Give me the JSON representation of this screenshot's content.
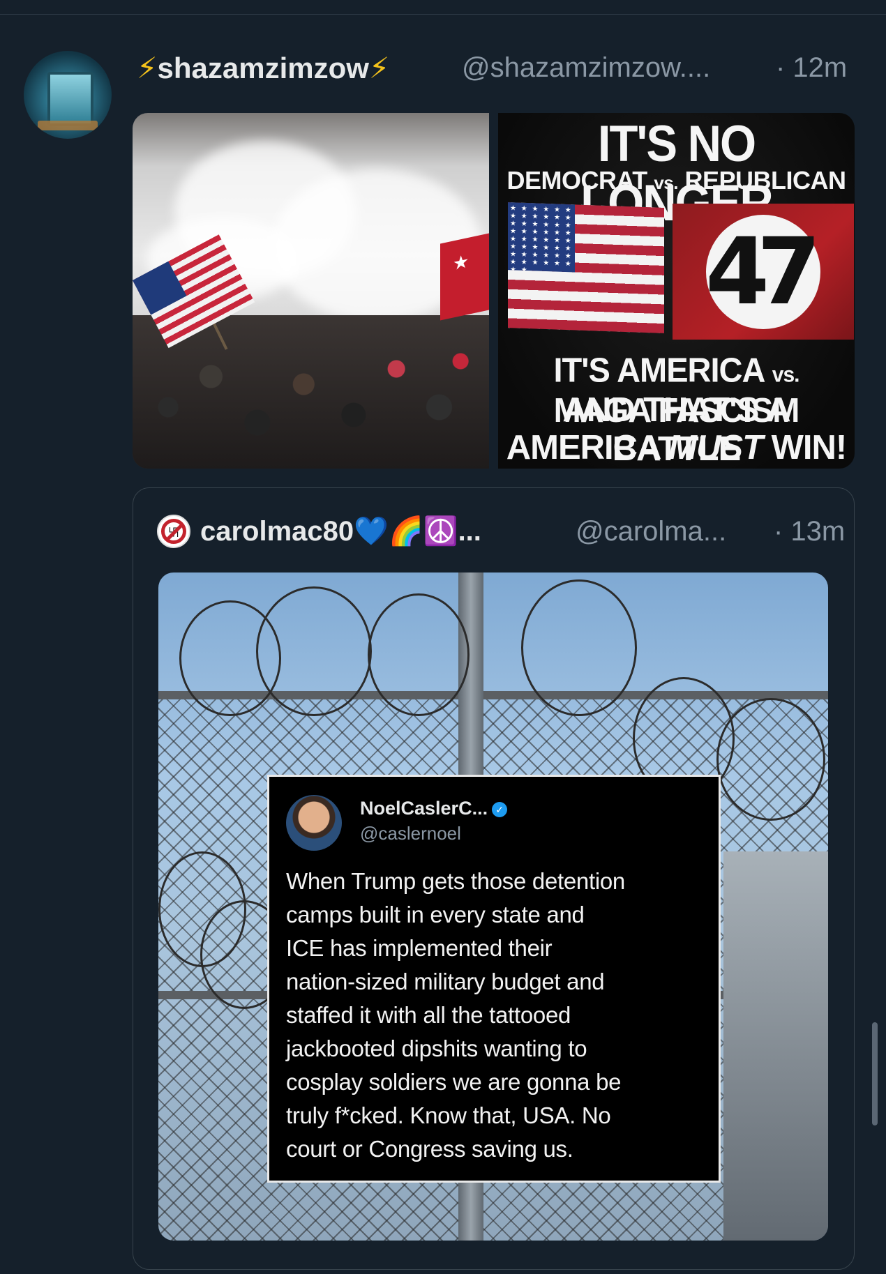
{
  "post": {
    "display_name": "shazamzimzow",
    "name_prefix_emoji": "⚡",
    "name_suffix_emoji": "⚡",
    "handle": "@shazamzimzow....",
    "time": "· 12m",
    "media": {
      "right_poster": {
        "title": "IT'S NO LONGER",
        "subtitle_a": "DEMOCRAT",
        "subtitle_vs": "vs.",
        "subtitle_b": "REPUBLICAN",
        "flag_number": "47",
        "line1_a": "IT'S AMERICA",
        "line1_vs": "vs.",
        "line1_b": "MAGA FASCISM",
        "line2": "AND THAT'S A BATTLE",
        "line3_a": "AMERICA",
        "line3_em": "MUST",
        "line3_b": "WIN!"
      }
    }
  },
  "quote": {
    "display_name": "carolmac80",
    "name_emojis": "💙🌈☮️...",
    "handle": "@carolma...",
    "time": "· 13m",
    "embedded_tweet": {
      "name": "NoelCaslerC...",
      "verified_mark": "✓",
      "handle": "@caslernoel",
      "text": "When Trump gets those detention\ncamps built in every state and\nICE has implemented their\nnation-sized military budget and\nstaffed it with all the tattooed\njackbooted dipshits wanting to\ncosplay soldiers we are gonna be\ntruly f*cked. Know that, USA. No\ncourt or Congress saving us."
    }
  },
  "colors": {
    "background": "#15202b",
    "secondary_text": "#8b98a5",
    "border": "#38444d",
    "bolt": "#f4c21b",
    "verified": "#1d9bf0"
  },
  "icons": [
    "lightning-icon",
    "blue-heart-icon",
    "rainbow-icon",
    "peace-icon",
    "verified-badge-icon",
    "no-swastika-avatar-icon"
  ]
}
